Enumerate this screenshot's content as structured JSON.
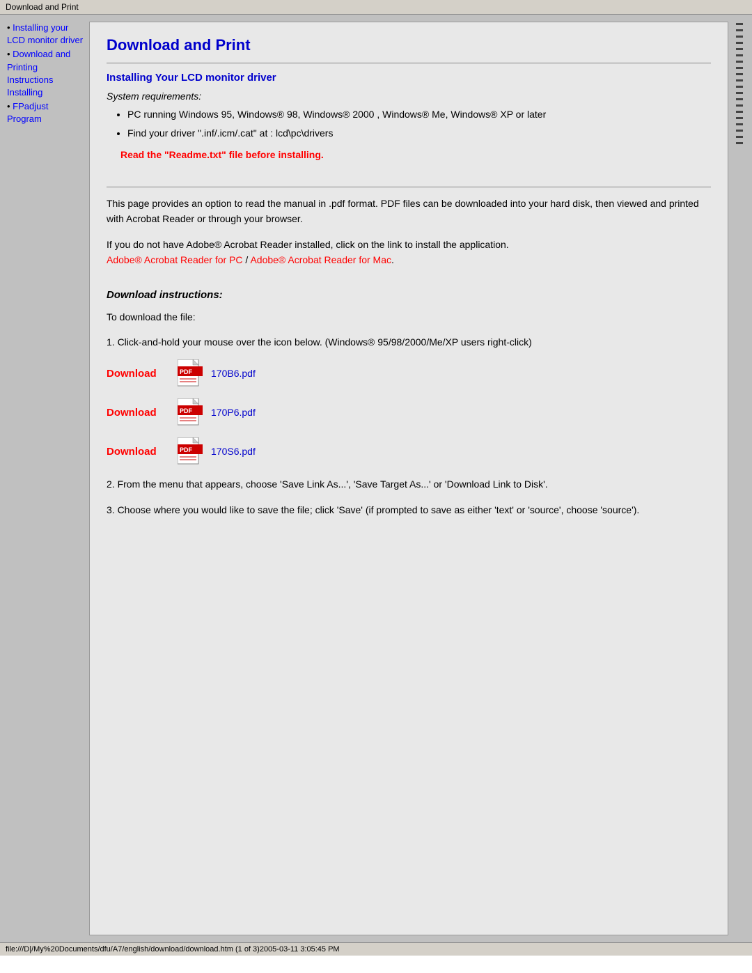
{
  "titlebar": {
    "label": "Download and Print"
  },
  "sidebar": {
    "items": [
      {
        "id": "installing-lcd",
        "label": "Installing your LCD monitor driver",
        "href": "#"
      },
      {
        "id": "download-printing",
        "label": "Download and Printing Instructions Installing",
        "href": "#"
      },
      {
        "id": "fpadjust",
        "label": "FPadjust Program",
        "href": "#"
      }
    ]
  },
  "page": {
    "title": "Download and Print",
    "section1": {
      "heading": "Installing Your LCD monitor driver",
      "system_req_label": "System requirements:",
      "bullets": [
        "PC running Windows 95, Windows® 98, Windows® 2000 , Windows® Me, Windows® XP or later",
        "Find your driver \".inf/.icm/.cat\" at : lcd\\pc\\drivers"
      ],
      "warning": "Read the \"Readme.txt\" file before installing."
    },
    "intro": {
      "paragraph1": "This page provides an option to read the manual in .pdf format. PDF files can be downloaded into your hard disk, then viewed and printed with Acrobat Reader or through your browser.",
      "paragraph2": "If you do not have Adobe® Acrobat Reader installed, click on the link to install the application.",
      "acrobat_pc": "Adobe® Acrobat Reader for PC",
      "slash": " / ",
      "acrobat_mac": "Adobe® Acrobat Reader for Mac"
    },
    "download_section": {
      "heading": "Download instructions:",
      "step1_intro": "To download the file:",
      "step1": "1. Click-and-hold your mouse over the icon below. (Windows® 95/98/2000/Me/XP users right-click)",
      "downloads": [
        {
          "id": "dl1",
          "link_label": "Download",
          "file_name": "170B6.pdf"
        },
        {
          "id": "dl2",
          "link_label": "Download",
          "file_name": "170P6.pdf"
        },
        {
          "id": "dl3",
          "link_label": "Download",
          "file_name": "170S6.pdf"
        }
      ],
      "step2": "2. From the menu that appears, choose 'Save Link As...', 'Save Target As...' or 'Download Link to Disk'.",
      "step3": "3. Choose where you would like to save the file; click 'Save' (if prompted to save as either 'text' or 'source', choose 'source')."
    }
  },
  "statusbar": {
    "label": "file:///D|/My%20Documents/dfu/A7/english/download/download.htm (1 of 3)2005-03-11 3:05:45 PM"
  }
}
